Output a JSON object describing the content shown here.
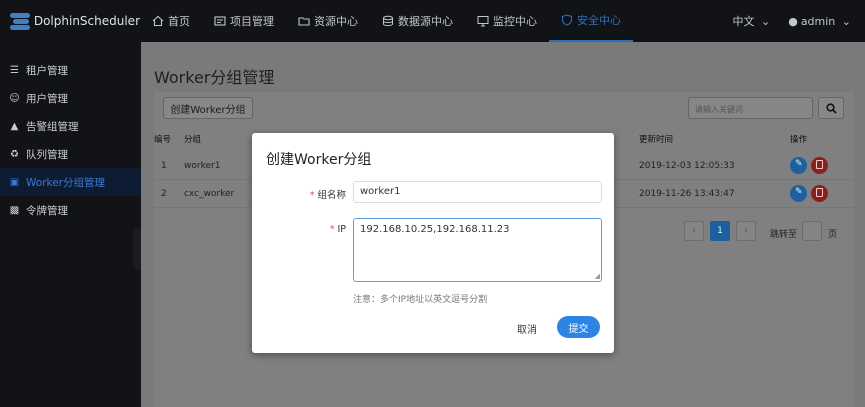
{
  "app": {
    "name": "DolphinScheduler"
  },
  "nav": [
    {
      "label": "首页",
      "icon": "home-icon"
    },
    {
      "label": "项目管理",
      "icon": "project-icon"
    },
    {
      "label": "资源中心",
      "icon": "folder-icon"
    },
    {
      "label": "数据源中心",
      "icon": "database-icon"
    },
    {
      "label": "监控中心",
      "icon": "monitor-icon"
    },
    {
      "label": "安全中心",
      "icon": "shield-icon"
    }
  ],
  "header_right": {
    "language": "中文",
    "user": "admin"
  },
  "sidebar": [
    {
      "label": "租户管理",
      "icon": "users-icon"
    },
    {
      "label": "用户管理",
      "icon": "user-icon"
    },
    {
      "label": "告警组管理",
      "icon": "warning-icon"
    },
    {
      "label": "队列管理",
      "icon": "recycle-icon"
    },
    {
      "label": "Worker分组管理",
      "icon": "worker-group-icon"
    },
    {
      "label": "令牌管理",
      "icon": "token-icon"
    }
  ],
  "page": {
    "title": "Worker分组管理",
    "create_button": "创建Worker分组",
    "search_placeholder": "请输入关键词"
  },
  "table": {
    "headers": {
      "no": "编号",
      "group": "分组",
      "update_time": "更新时间",
      "ops": "操作"
    },
    "rows": [
      {
        "no": "1",
        "group": "worker1",
        "update_time": "2019-12-03 12:05:33"
      },
      {
        "no": "2",
        "group": "cxc_worker",
        "update_time": "2019-11-26 13:43:47"
      }
    ]
  },
  "pagination": {
    "current": "1",
    "jump_label": "跳转至",
    "page_suffix": "页"
  },
  "dialog": {
    "title": "创建Worker分组",
    "name_label": "组名称",
    "name_value": "worker1",
    "ip_label": "IP",
    "ip_value": "192.168.10.25,192.168.11.23",
    "note": "注意：多个IP地址以英文逗号分割",
    "cancel": "取消",
    "submit": "提交"
  },
  "colors": {
    "accent": "#2f84e3",
    "required": "#e24a4a"
  }
}
